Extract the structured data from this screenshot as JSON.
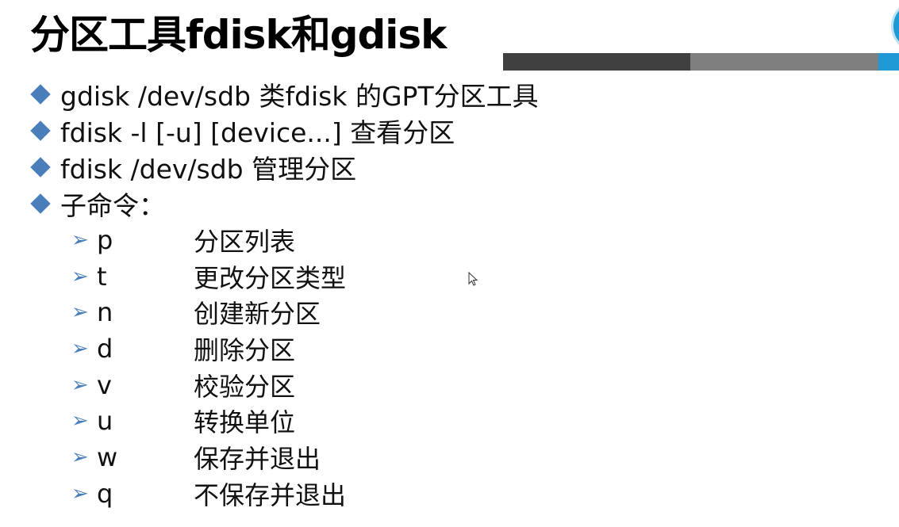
{
  "slide": {
    "title": "分区工具fdisk和gdisk",
    "bullets": [
      {
        "text": "gdisk /dev/sdb 类fdisk 的GPT分区工具"
      },
      {
        "text": "fdisk -l [-u] [device...] 查看分区"
      },
      {
        "text": "fdisk /dev/sdb  管理分区"
      },
      {
        "text": "子命令："
      }
    ],
    "subcommands": [
      {
        "cmd": "p",
        "desc": "分区列表"
      },
      {
        "cmd": "t",
        "desc": "更改分区类型"
      },
      {
        "cmd": "n",
        "desc": "创建新分区"
      },
      {
        "cmd": "d",
        "desc": "删除分区"
      },
      {
        "cmd": "v",
        "desc": "校验分区"
      },
      {
        "cmd": "u",
        "desc": "转换单位"
      },
      {
        "cmd": "w",
        "desc": "保存并退出"
      },
      {
        "cmd": "q",
        "desc": "不保存并退出"
      }
    ],
    "colors": {
      "bullet": "#4a7ebb",
      "bar_dark": "#404040",
      "bar_gray": "#7f7f7f",
      "accent_blue": "#1f9ad6"
    },
    "icons": {
      "bullet": "diamond-bullet-icon",
      "sub_bullet": "arrow-bullet-icon",
      "cursor": "mouse-cursor-icon"
    }
  }
}
